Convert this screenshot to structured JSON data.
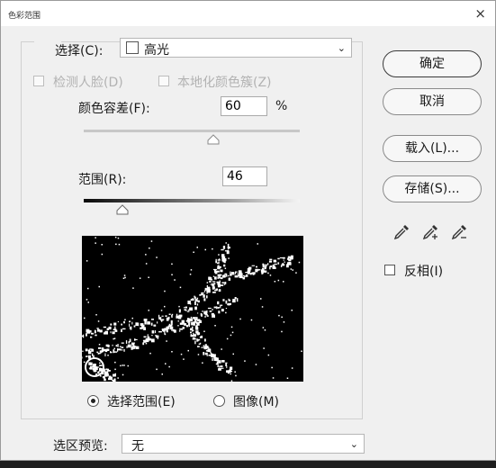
{
  "window": {
    "title": "色彩范围",
    "close_glyph": "×"
  },
  "select": {
    "label": "选择(C):",
    "value": "高光",
    "swatch_color": "#ffffff"
  },
  "detect_faces": {
    "label": "检测人脸(D)",
    "checked": false,
    "enabled": false
  },
  "localized_clusters": {
    "label": "本地化颜色簇(Z)",
    "checked": false,
    "enabled": false
  },
  "fuzziness": {
    "label": "颜色容差(F):",
    "value": "60",
    "unit": "%",
    "enabled": false
  },
  "range": {
    "label": "范围(R):",
    "value": "46"
  },
  "view_mode": {
    "options": [
      {
        "label": "选择范围(E)",
        "selected": true
      },
      {
        "label": "图像(M)",
        "selected": false
      }
    ]
  },
  "preview_mode": {
    "label": "选区预览:",
    "value": "无"
  },
  "buttons": {
    "ok": "确定",
    "cancel": "取消",
    "load": "载入(L)...",
    "save": "存储(S)..."
  },
  "eyedroppers": [
    "eyedropper-icon",
    "eyedropper-plus-icon",
    "eyedropper-minus-icon"
  ],
  "invert": {
    "label": "反相(I)",
    "checked": false
  },
  "colors": {
    "dialog_bg": "#f0f0f0",
    "preview_bg": "#000000",
    "mask_white": "#ffffff",
    "disabled_text": "#b2b2b2"
  }
}
